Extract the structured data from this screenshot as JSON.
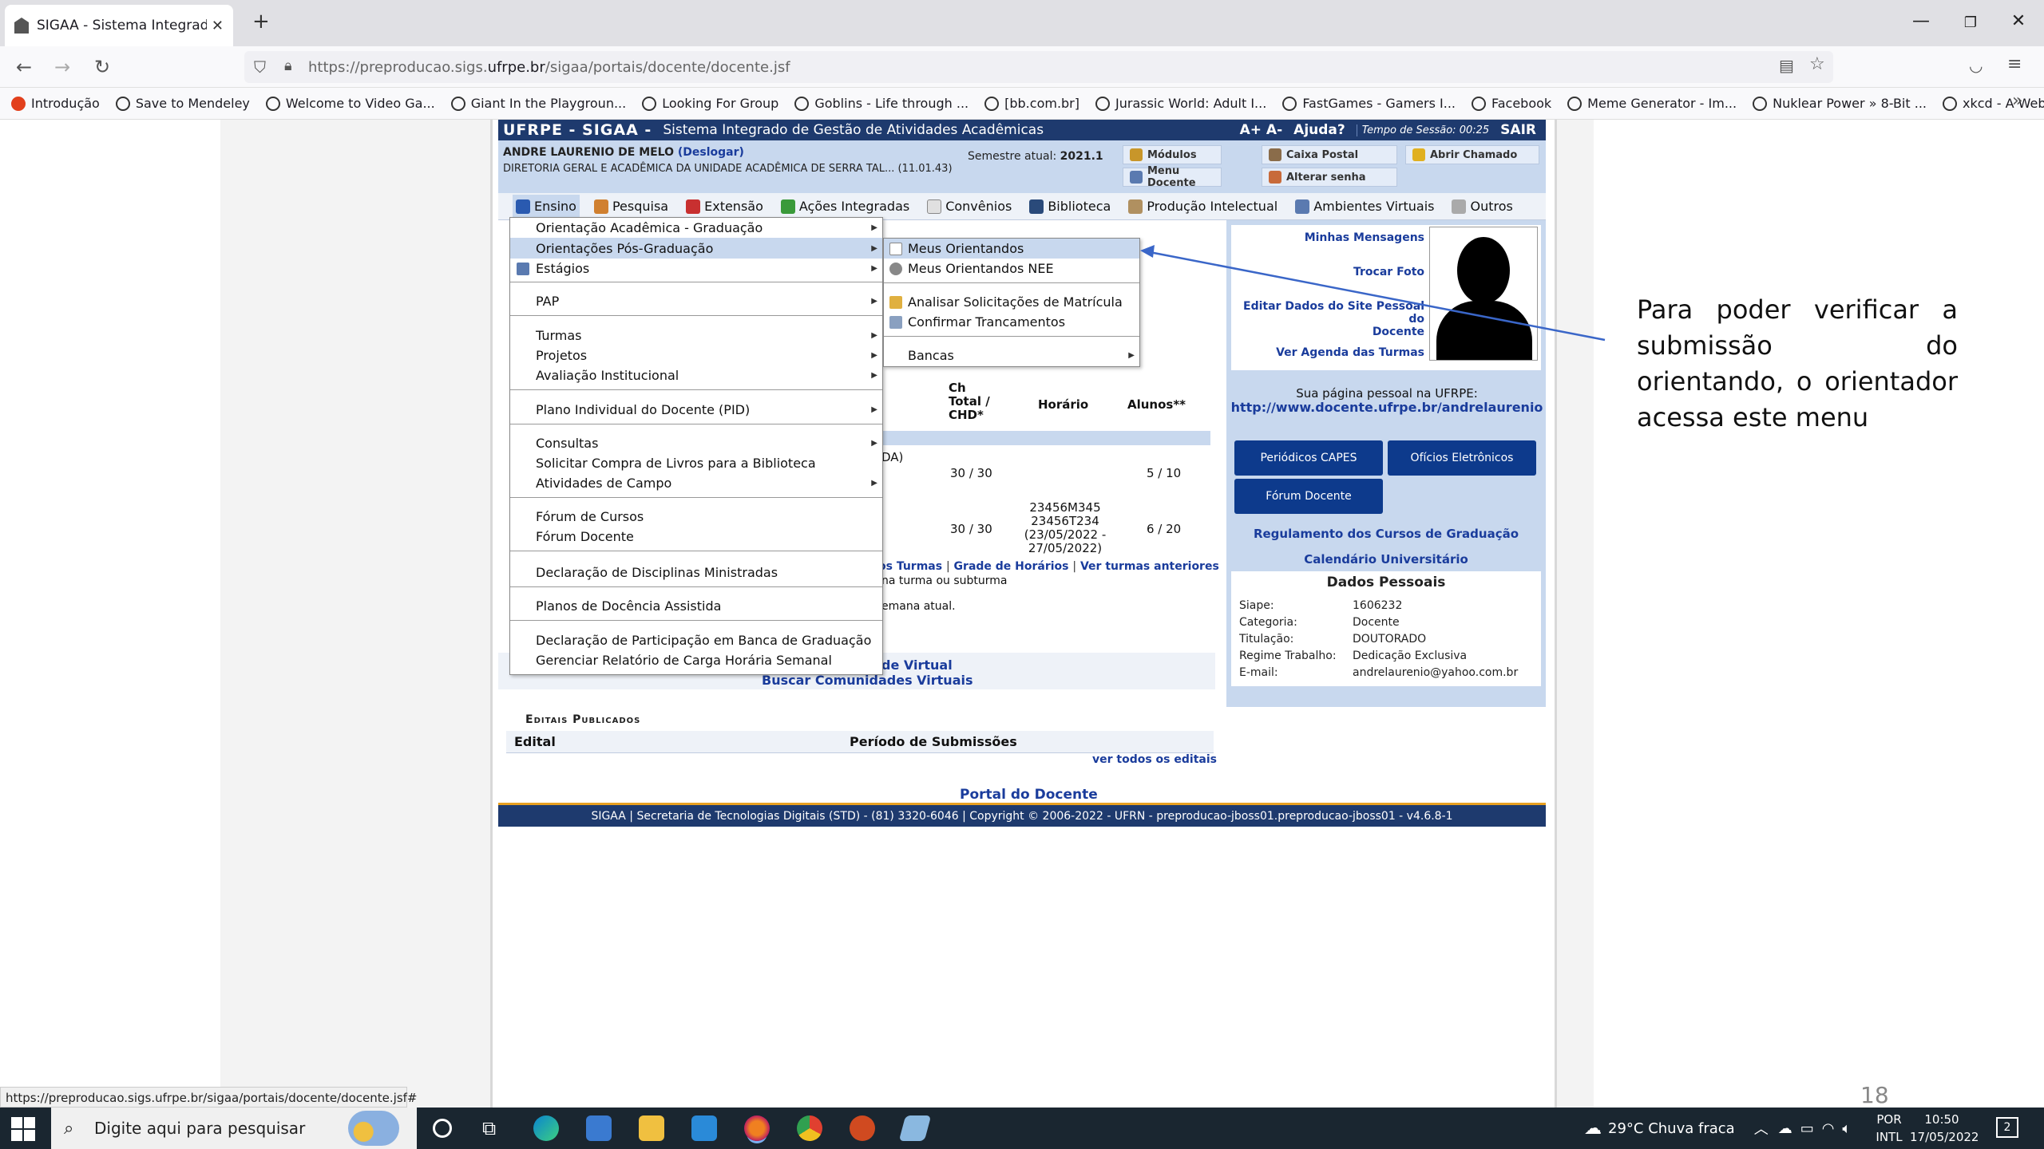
{
  "browser": {
    "tab_title": "SIGAA - Sistema Integrado de G",
    "new_tab": "+",
    "url_gray": "https://preproducao.sigs.",
    "url_host": "ufrpe.br",
    "url_path": "/sigaa/portais/docente/docente.jsf",
    "bookmarks": [
      "Introdução",
      "Save to Mendeley",
      "Welcome to Video Ga...",
      "Giant In the Playgroun...",
      "Looking For Group",
      "Goblins - Life through ...",
      "[bb.com.br]",
      "Jurassic World: Adult I...",
      "FastGames - Gamers I...",
      "Facebook",
      "Meme Generator - Im...",
      "Nuklear Power » 8-Bit ...",
      "xkcd - A Webcomic - ..."
    ],
    "status_url": "https://preproducao.sigs.ufrpe.br/sigaa/portais/docente/docente.jsf#"
  },
  "sigaa": {
    "brand": "UFRPE - SIGAA -",
    "subtitle": "Sistema Integrado de Gestão de Atividades Acadêmicas",
    "font_controls": "A+  A-",
    "help": "Ajuda?",
    "session": "Tempo de Sessão: 00:25",
    "logout": "SAIR",
    "user_name": "ANDRE LAURENIO DE MELO",
    "logoff": "(Deslogar)",
    "department": "DIRETORIA GERAL E ACADÊMICA DA UNIDADE ACADÊMICA DE SERRA TAL... (11.01.43)",
    "semester_label": "Semestre atual:",
    "semester_value": "2021.1",
    "quick": {
      "modulos": "Módulos",
      "caixa_postal": "Caixa Postal",
      "abrir_chamado": "Abrir Chamado",
      "menu_docente": "Menu Docente",
      "alterar_senha": "Alterar senha"
    }
  },
  "menu": {
    "ensino": "Ensino",
    "pesquisa": "Pesquisa",
    "extensao": "Extensão",
    "acoes": "Ações Integradas",
    "convenios": "Convênios",
    "biblioteca": "Biblioteca",
    "producao": "Produção Intelectual",
    "ambientes": "Ambientes Virtuais",
    "outros": "Outros"
  },
  "dropdown": {
    "items": [
      "Orientação Acadêmica - Graduação",
      "Orientações Pós-Graduação",
      "Estágios",
      "PAP",
      "Turmas",
      "Projetos",
      "Avaliação Institucional",
      "Plano Individual do Docente (PID)",
      "Consultas",
      "Solicitar Compra de Livros para a Biblioteca",
      "Atividades de Campo",
      "Fórum de Cursos",
      "Fórum Docente",
      "Declaração de Disciplinas Ministradas",
      "Planos de Docência Assistida",
      "Declaração de Participação em Banca de Graduação",
      "Gerenciar Relatório de Carga Horária Semanal"
    ]
  },
  "submenu": {
    "items": [
      "Meus Orientandos",
      "Meus Orientandos NEE",
      "Analisar Solicitações de Matrícula",
      "Confirmar Trancamentos",
      "Bancas"
    ]
  },
  "table": {
    "col_ch_1": "Ch",
    "col_ch_2": "Total /",
    "col_ch_3": "CHD*",
    "col_horario": "Horário",
    "col_alunos": "Alunos**",
    "row1_frag": "DA)",
    "row1_ch": "30 / 30",
    "row1_alunos": "5 / 10",
    "row2_ch": "30 / 30",
    "row2_h1": "23456M345",
    "row2_h2": "23456T234",
    "row2_h3": "(23/05/2022 -",
    "row2_h4": "27/05/2022)",
    "row2_alunos": "6 / 20",
    "link_turmas": "os Turmas",
    "link_grade": "Grade de Horários",
    "link_anteriores": "Ver turmas anteriores",
    "note1": "na turma ou subturma",
    "note2": "emana atual."
  },
  "comunidades": {
    "frag": "de Virtual",
    "buscar": "Buscar Comunidades Virtuais"
  },
  "editais": {
    "title": "Editais Publicados",
    "col_edital": "Edital",
    "col_periodo": "Período de Submissões",
    "more": "ver todos os editais"
  },
  "portal_link": "Portal do Docente",
  "footer": "SIGAA | Secretaria de Tecnologias Digitais (STD) - (81) 3320-6046 | Copyright © 2006-2022 - UFRN - preproducao-jboss01.preproducao-jboss01 - v4.6.8-1",
  "panel": {
    "mensagens": "Minhas Mensagens",
    "foto": "Trocar Foto",
    "editar_1": "Editar Dados do Site Pessoal do",
    "editar_2": "Docente",
    "agenda": "Ver Agenda das Turmas",
    "pagina_label": "Sua página pessoal na UFRPE:",
    "pagina_url": "http://www.docente.ufrpe.br/andrelaurenio",
    "btn_capes": "Periódicos CAPES",
    "btn_oficios": "Ofícios Eletrônicos",
    "btn_forum": "Fórum Docente",
    "regulamento": "Regulamento dos Cursos de Graduação",
    "calendario": "Calendário Universitário",
    "dados_title": "Dados Pessoais",
    "siape_l": "Siape:",
    "siape_v": "1606232",
    "categoria_l": "Categoria:",
    "categoria_v": "Docente",
    "titulacao_l": "Titulação:",
    "titulacao_v": "DOUTORADO",
    "regime_l": "Regime Trabalho:",
    "regime_v": "Dedicação Exclusiva",
    "email_l": "E-mail:",
    "email_v": "andrelaurenio@yahoo.com.br"
  },
  "annotation": "Para poder verificar a submissão do orientando, o orientador acessa este menu",
  "page_number": "18",
  "taskbar": {
    "search_placeholder": "Digite aqui para pesquisar",
    "weather": "29°C  Chuva fraca",
    "lang_1": "POR",
    "lang_2": "INTL",
    "time": "10:50",
    "date": "17/05/2022",
    "notif": "2"
  }
}
